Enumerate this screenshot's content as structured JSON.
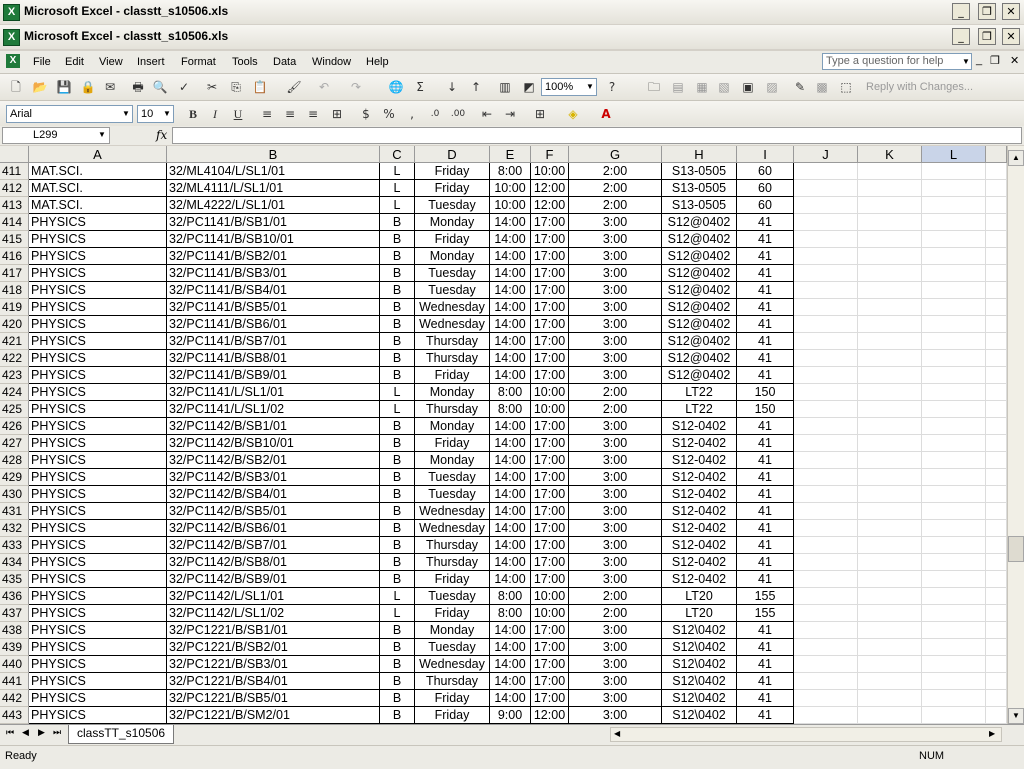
{
  "app_title": "Microsoft Excel - classtt_s10506.xls",
  "window_title": "Microsoft Excel - classtt_s10506.xls",
  "menu": [
    "File",
    "Edit",
    "View",
    "Insert",
    "Format",
    "Tools",
    "Data",
    "Window",
    "Help"
  ],
  "help_box": {
    "placeholder": "Type a question for help"
  },
  "toolbar": {
    "zoom": "100%",
    "reply_with_changes": "Reply with Changes..."
  },
  "format_toolbar": {
    "font": "Arial",
    "size": "10"
  },
  "formula_bar": {
    "name_box": "L299",
    "fx": "fx",
    "content": ""
  },
  "columns": [
    "A",
    "B",
    "C",
    "D",
    "E",
    "F",
    "G",
    "H",
    "I",
    "J",
    "K",
    "L"
  ],
  "rows": [
    {
      "n": "411",
      "a": "MAT.SCI.",
      "b": "32/ML4104/L/SL1/01",
      "c": "L",
      "d": "Friday",
      "e": "8:00",
      "f": "10:00",
      "g": "2:00",
      "h": "S13-0505",
      "i": "60"
    },
    {
      "n": "412",
      "a": "MAT.SCI.",
      "b": "32/ML4111/L/SL1/01",
      "c": "L",
      "d": "Friday",
      "e": "10:00",
      "f": "12:00",
      "g": "2:00",
      "h": "S13-0505",
      "i": "60"
    },
    {
      "n": "413",
      "a": "MAT.SCI.",
      "b": "32/ML4222/L/SL1/01",
      "c": "L",
      "d": "Tuesday",
      "e": "10:00",
      "f": "12:00",
      "g": "2:00",
      "h": "S13-0505",
      "i": "60"
    },
    {
      "n": "414",
      "a": "PHYSICS",
      "b": "32/PC1141/B/SB1/01",
      "c": "B",
      "d": "Monday",
      "e": "14:00",
      "f": "17:00",
      "g": "3:00",
      "h": "S12@0402",
      "i": "41"
    },
    {
      "n": "415",
      "a": "PHYSICS",
      "b": "32/PC1141/B/SB10/01",
      "c": "B",
      "d": "Friday",
      "e": "14:00",
      "f": "17:00",
      "g": "3:00",
      "h": "S12@0402",
      "i": "41"
    },
    {
      "n": "416",
      "a": "PHYSICS",
      "b": "32/PC1141/B/SB2/01",
      "c": "B",
      "d": "Monday",
      "e": "14:00",
      "f": "17:00",
      "g": "3:00",
      "h": "S12@0402",
      "i": "41"
    },
    {
      "n": "417",
      "a": "PHYSICS",
      "b": "32/PC1141/B/SB3/01",
      "c": "B",
      "d": "Tuesday",
      "e": "14:00",
      "f": "17:00",
      "g": "3:00",
      "h": "S12@0402",
      "i": "41"
    },
    {
      "n": "418",
      "a": "PHYSICS",
      "b": "32/PC1141/B/SB4/01",
      "c": "B",
      "d": "Tuesday",
      "e": "14:00",
      "f": "17:00",
      "g": "3:00",
      "h": "S12@0402",
      "i": "41"
    },
    {
      "n": "419",
      "a": "PHYSICS",
      "b": "32/PC1141/B/SB5/01",
      "c": "B",
      "d": "Wednesday",
      "e": "14:00",
      "f": "17:00",
      "g": "3:00",
      "h": "S12@0402",
      "i": "41"
    },
    {
      "n": "420",
      "a": "PHYSICS",
      "b": "32/PC1141/B/SB6/01",
      "c": "B",
      "d": "Wednesday",
      "e": "14:00",
      "f": "17:00",
      "g": "3:00",
      "h": "S12@0402",
      "i": "41"
    },
    {
      "n": "421",
      "a": "PHYSICS",
      "b": "32/PC1141/B/SB7/01",
      "c": "B",
      "d": "Thursday",
      "e": "14:00",
      "f": "17:00",
      "g": "3:00",
      "h": "S12@0402",
      "i": "41"
    },
    {
      "n": "422",
      "a": "PHYSICS",
      "b": "32/PC1141/B/SB8/01",
      "c": "B",
      "d": "Thursday",
      "e": "14:00",
      "f": "17:00",
      "g": "3:00",
      "h": "S12@0402",
      "i": "41"
    },
    {
      "n": "423",
      "a": "PHYSICS",
      "b": "32/PC1141/B/SB9/01",
      "c": "B",
      "d": "Friday",
      "e": "14:00",
      "f": "17:00",
      "g": "3:00",
      "h": "S12@0402",
      "i": "41"
    },
    {
      "n": "424",
      "a": "PHYSICS",
      "b": "32/PC1141/L/SL1/01",
      "c": "L",
      "d": "Monday",
      "e": "8:00",
      "f": "10:00",
      "g": "2:00",
      "h": "LT22",
      "i": "150"
    },
    {
      "n": "425",
      "a": "PHYSICS",
      "b": "32/PC1141/L/SL1/02",
      "c": "L",
      "d": "Thursday",
      "e": "8:00",
      "f": "10:00",
      "g": "2:00",
      "h": "LT22",
      "i": "150"
    },
    {
      "n": "426",
      "a": "PHYSICS",
      "b": "32/PC1142/B/SB1/01",
      "c": "B",
      "d": "Monday",
      "e": "14:00",
      "f": "17:00",
      "g": "3:00",
      "h": "S12-0402",
      "i": "41"
    },
    {
      "n": "427",
      "a": "PHYSICS",
      "b": "32/PC1142/B/SB10/01",
      "c": "B",
      "d": "Friday",
      "e": "14:00",
      "f": "17:00",
      "g": "3:00",
      "h": "S12-0402",
      "i": "41"
    },
    {
      "n": "428",
      "a": "PHYSICS",
      "b": "32/PC1142/B/SB2/01",
      "c": "B",
      "d": "Monday",
      "e": "14:00",
      "f": "17:00",
      "g": "3:00",
      "h": "S12-0402",
      "i": "41"
    },
    {
      "n": "429",
      "a": "PHYSICS",
      "b": "32/PC1142/B/SB3/01",
      "c": "B",
      "d": "Tuesday",
      "e": "14:00",
      "f": "17:00",
      "g": "3:00",
      "h": "S12-0402",
      "i": "41"
    },
    {
      "n": "430",
      "a": "PHYSICS",
      "b": "32/PC1142/B/SB4/01",
      "c": "B",
      "d": "Tuesday",
      "e": "14:00",
      "f": "17:00",
      "g": "3:00",
      "h": "S12-0402",
      "i": "41"
    },
    {
      "n": "431",
      "a": "PHYSICS",
      "b": "32/PC1142/B/SB5/01",
      "c": "B",
      "d": "Wednesday",
      "e": "14:00",
      "f": "17:00",
      "g": "3:00",
      "h": "S12-0402",
      "i": "41"
    },
    {
      "n": "432",
      "a": "PHYSICS",
      "b": "32/PC1142/B/SB6/01",
      "c": "B",
      "d": "Wednesday",
      "e": "14:00",
      "f": "17:00",
      "g": "3:00",
      "h": "S12-0402",
      "i": "41"
    },
    {
      "n": "433",
      "a": "PHYSICS",
      "b": "32/PC1142/B/SB7/01",
      "c": "B",
      "d": "Thursday",
      "e": "14:00",
      "f": "17:00",
      "g": "3:00",
      "h": "S12-0402",
      "i": "41"
    },
    {
      "n": "434",
      "a": "PHYSICS",
      "b": "32/PC1142/B/SB8/01",
      "c": "B",
      "d": "Thursday",
      "e": "14:00",
      "f": "17:00",
      "g": "3:00",
      "h": "S12-0402",
      "i": "41"
    },
    {
      "n": "435",
      "a": "PHYSICS",
      "b": "32/PC1142/B/SB9/01",
      "c": "B",
      "d": "Friday",
      "e": "14:00",
      "f": "17:00",
      "g": "3:00",
      "h": "S12-0402",
      "i": "41"
    },
    {
      "n": "436",
      "a": "PHYSICS",
      "b": "32/PC1142/L/SL1/01",
      "c": "L",
      "d": "Tuesday",
      "e": "8:00",
      "f": "10:00",
      "g": "2:00",
      "h": "LT20",
      "i": "155"
    },
    {
      "n": "437",
      "a": "PHYSICS",
      "b": "32/PC1142/L/SL1/02",
      "c": "L",
      "d": "Friday",
      "e": "8:00",
      "f": "10:00",
      "g": "2:00",
      "h": "LT20",
      "i": "155"
    },
    {
      "n": "438",
      "a": "PHYSICS",
      "b": "32/PC1221/B/SB1/01",
      "c": "B",
      "d": "Monday",
      "e": "14:00",
      "f": "17:00",
      "g": "3:00",
      "h": "S12\\0402",
      "i": "41"
    },
    {
      "n": "439",
      "a": "PHYSICS",
      "b": "32/PC1221/B/SB2/01",
      "c": "B",
      "d": "Tuesday",
      "e": "14:00",
      "f": "17:00",
      "g": "3:00",
      "h": "S12\\0402",
      "i": "41"
    },
    {
      "n": "440",
      "a": "PHYSICS",
      "b": "32/PC1221/B/SB3/01",
      "c": "B",
      "d": "Wednesday",
      "e": "14:00",
      "f": "17:00",
      "g": "3:00",
      "h": "S12\\0402",
      "i": "41"
    },
    {
      "n": "441",
      "a": "PHYSICS",
      "b": "32/PC1221/B/SB4/01",
      "c": "B",
      "d": "Thursday",
      "e": "14:00",
      "f": "17:00",
      "g": "3:00",
      "h": "S12\\0402",
      "i": "41"
    },
    {
      "n": "442",
      "a": "PHYSICS",
      "b": "32/PC1221/B/SB5/01",
      "c": "B",
      "d": "Friday",
      "e": "14:00",
      "f": "17:00",
      "g": "3:00",
      "h": "S12\\0402",
      "i": "41"
    },
    {
      "n": "443",
      "a": "PHYSICS",
      "b": "32/PC1221/B/SM2/01",
      "c": "B",
      "d": "Friday",
      "e": "9:00",
      "f": "12:00",
      "g": "3:00",
      "h": "S12\\0402",
      "i": "41"
    }
  ],
  "sheet_tab": "classTT_s10506",
  "status": {
    "left": "Ready",
    "num": "NUM"
  }
}
